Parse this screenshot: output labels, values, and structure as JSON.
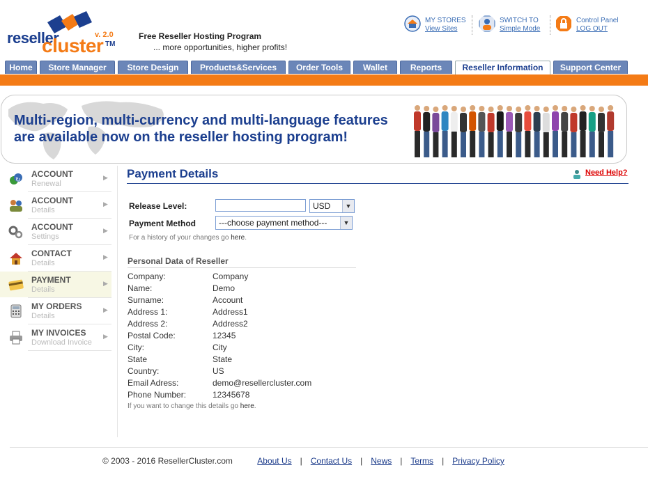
{
  "header": {
    "logo_word1": "reseller",
    "logo_word2": "cluster",
    "logo_version": "v. 2.0",
    "logo_tm": "TM",
    "tagline_title": "Free Reseller Hosting Program",
    "tagline_sub": "... more opportunities, higher profits!",
    "links": [
      {
        "title": "MY STORES",
        "link": "View Sites"
      },
      {
        "title": "SWITCH TO",
        "link": "Simple Mode"
      },
      {
        "title": "Control Panel",
        "link": "LOG OUT"
      }
    ]
  },
  "nav": {
    "tabs": [
      "Home",
      "Store Manager",
      "Store Design",
      "Products&Services",
      "Order Tools",
      "Wallet",
      "Reports",
      "Reseller Information",
      "Support Center"
    ],
    "active": "Reseller Information"
  },
  "banner": {
    "line1": "Multi-region, multi-currency and multi-language features",
    "line2": "are available now on the reseller hosting program!"
  },
  "sidebar": {
    "items": [
      {
        "label": "ACCOUNT",
        "sub": "Renewal"
      },
      {
        "label": "ACCOUNT",
        "sub": "Details"
      },
      {
        "label": "ACCOUNT",
        "sub": "Settings"
      },
      {
        "label": "CONTACT",
        "sub": "Details"
      },
      {
        "label": "PAYMENT",
        "sub": "Details"
      },
      {
        "label": "MY ORDERS",
        "sub": "Details"
      },
      {
        "label": "MY INVOICES",
        "sub": "Download Invoice"
      }
    ],
    "arrow": "▶"
  },
  "main": {
    "title": "Payment Details",
    "help": "Need Help?",
    "release_label": "Release Level:",
    "release_value": "",
    "currency": "USD",
    "method_label": "Payment Method",
    "method_value": "---choose payment method---",
    "history_note": "For a history of your changes go",
    "history_link": "here",
    "personal_title": "Personal Data of Reseller",
    "fields": [
      {
        "k": "Company:",
        "v": "Company"
      },
      {
        "k": "Name:",
        "v": "Demo"
      },
      {
        "k": "Surname:",
        "v": "Account"
      },
      {
        "k": "Address 1:",
        "v": "Address1"
      },
      {
        "k": "Address 2:",
        "v": "Address2"
      },
      {
        "k": "Postal Code:",
        "v": "12345"
      },
      {
        "k": "City:",
        "v": "City"
      },
      {
        "k": "State",
        "v": "State"
      },
      {
        "k": "Country:",
        "v": "US"
      },
      {
        "k": "Email Adress:",
        "v": "demo@resellercluster.com"
      },
      {
        "k": "Phone Number:",
        "v": "12345678"
      }
    ],
    "change_note": "If you want to change this details go",
    "change_link": "here"
  },
  "footer": {
    "copyright": "© 2003 - 2016 ResellerCluster.com",
    "links": [
      "About Us",
      "Contact Us",
      "News",
      "Terms",
      "Privacy Policy"
    ],
    "sep": "|"
  },
  "colors": {
    "brand_blue": "#1c3f8f",
    "brand_orange": "#f47b16",
    "tab_blue": "#6b86b8"
  }
}
